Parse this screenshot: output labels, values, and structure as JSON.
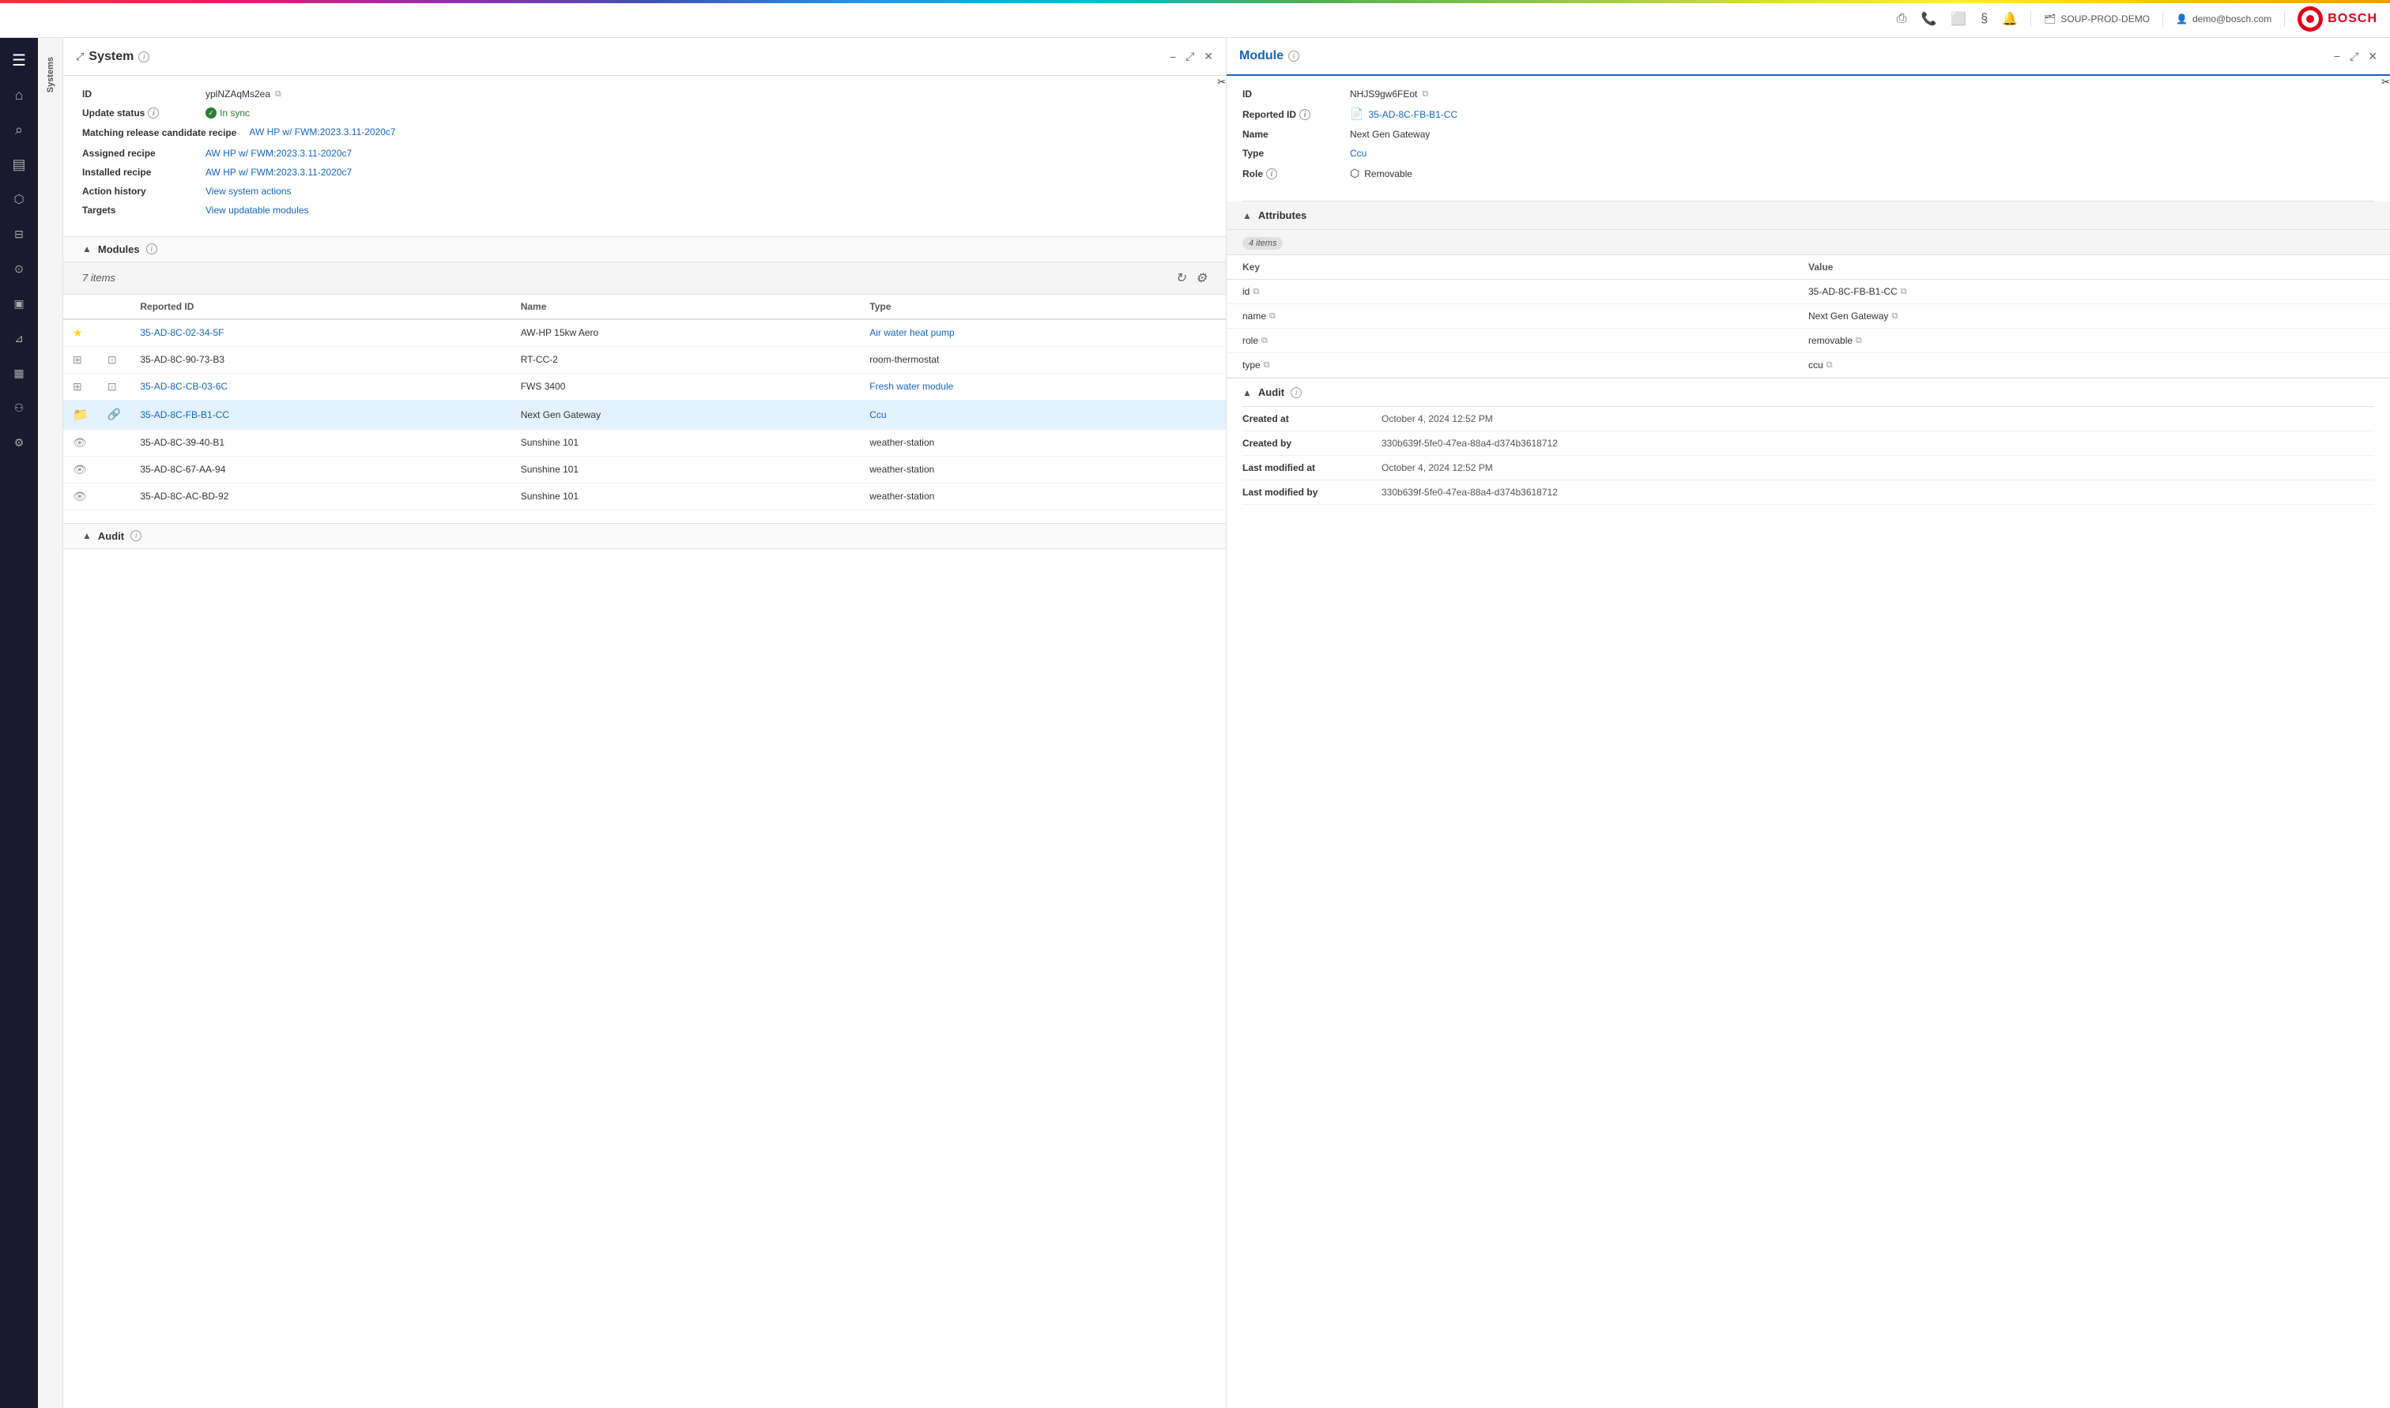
{
  "topbar": {
    "env_label": "SOUP-PROD-DEMO",
    "user_label": "demo@bosch.com",
    "bosch_text": "BOSCH"
  },
  "sidebar": {
    "items": [
      {
        "id": "menu",
        "icon": "☰",
        "label": "Menu"
      },
      {
        "id": "home",
        "icon": "⌂",
        "label": "Home"
      },
      {
        "id": "search",
        "icon": "⌕",
        "label": "Search"
      },
      {
        "id": "chart",
        "icon": "▤",
        "label": "Chart"
      },
      {
        "id": "network",
        "icon": "⬡",
        "label": "Network"
      },
      {
        "id": "list",
        "icon": "☰",
        "label": "List"
      },
      {
        "id": "vehicle",
        "icon": "⊙",
        "label": "Vehicle"
      },
      {
        "id": "package",
        "icon": "▣",
        "label": "Package"
      },
      {
        "id": "filter",
        "icon": "⊿",
        "label": "Filter"
      },
      {
        "id": "analytics",
        "icon": "▦",
        "label": "Analytics"
      },
      {
        "id": "users",
        "icon": "⚇",
        "label": "Users"
      },
      {
        "id": "settings",
        "icon": "⚙",
        "label": "Settings"
      }
    ],
    "tab_label": "Systems"
  },
  "system_panel": {
    "title": "System",
    "id_label": "ID",
    "id_value": "yplNZAqMs2ea",
    "update_status_label": "Update status",
    "update_status_icon_label": "i",
    "update_status_value": "In sync",
    "matching_release_label": "Matching release candidate recipe",
    "matching_release_value": "AW HP w/ FWM:2023.3.11-2020c7",
    "assigned_recipe_label": "Assigned recipe",
    "assigned_recipe_value": "AW HP w/ FWM:2023.3.11-2020c7",
    "installed_recipe_label": "Installed recipe",
    "installed_recipe_value": "AW HP w/ FWM:2023.3.11-2020c7",
    "action_history_label": "Action history",
    "action_history_value": "View system actions",
    "targets_label": "Targets",
    "targets_value": "View updatable modules",
    "modules_section": {
      "title": "Modules",
      "count": "7 items",
      "columns": {
        "reported_id": "Reported ID",
        "name": "Name",
        "type": "Type"
      },
      "rows": [
        {
          "id": "35-AD-8C-02-34-5F",
          "name": "AW-HP 15kw Aero",
          "type": "Air water heat pump",
          "icon": "star",
          "id_is_link": true,
          "type_is_link": true
        },
        {
          "id": "35-AD-8C-90-73-B3",
          "name": "RT-CC-2",
          "type": "room-thermostat",
          "icon": "grid",
          "id_is_link": false,
          "type_is_link": false
        },
        {
          "id": "35-AD-8C-CB-03-6C",
          "name": "FWS 3400",
          "type": "Fresh water module",
          "icon": "grid",
          "id_is_link": true,
          "type_is_link": true
        },
        {
          "id": "35-AD-8C-FB-B1-CC",
          "name": "Next Gen Gateway",
          "type": "Ccu",
          "icon": "folder",
          "id_is_link": true,
          "type_is_link": true,
          "selected": true
        },
        {
          "id": "35-AD-8C-39-40-B1",
          "name": "Sunshine 101",
          "type": "weather-station",
          "icon": "eye",
          "id_is_link": false,
          "type_is_link": false
        },
        {
          "id": "35-AD-8C-67-AA-94",
          "name": "Sunshine 101",
          "type": "weather-station",
          "icon": "eye",
          "id_is_link": false,
          "type_is_link": false
        },
        {
          "id": "35-AD-8C-AC-BD-92",
          "name": "Sunshine 101",
          "type": "weather-station",
          "icon": "eye",
          "id_is_link": false,
          "type_is_link": false
        }
      ]
    }
  },
  "module_panel": {
    "title": "Module",
    "id_label": "ID",
    "id_value": "NHJS9gw6FEot",
    "reported_id_label": "Reported ID",
    "reported_id_value": "35-AD-8C-FB-B1-CC",
    "name_label": "Name",
    "name_value": "Next Gen Gateway",
    "type_label": "Type",
    "type_value": "Ccu",
    "role_label": "Role",
    "role_value": "Removable",
    "attributes_section": {
      "title": "Attributes",
      "count": "4 items",
      "key_header": "Key",
      "value_header": "Value",
      "rows": [
        {
          "key": "id",
          "value": "35-AD-8C-FB-B1-CC"
        },
        {
          "key": "name",
          "value": "Next Gen Gateway"
        },
        {
          "key": "role",
          "value": "removable"
        },
        {
          "key": "type",
          "value": "ccu"
        }
      ]
    },
    "audit_section": {
      "title": "Audit",
      "created_at_label": "Created at",
      "created_at_value": "October 4, 2024 12:52 PM",
      "created_by_label": "Created by",
      "created_by_value": "330b639f-5fe0-47ea-88a4-d374b3618712",
      "last_modified_at_label": "Last modified at",
      "last_modified_at_value": "October 4, 2024 12:52 PM",
      "last_modified_by_label": "Last modified by",
      "last_modified_by_value": "330b639f-5fe0-47ea-88a4-d374b3618712"
    }
  }
}
